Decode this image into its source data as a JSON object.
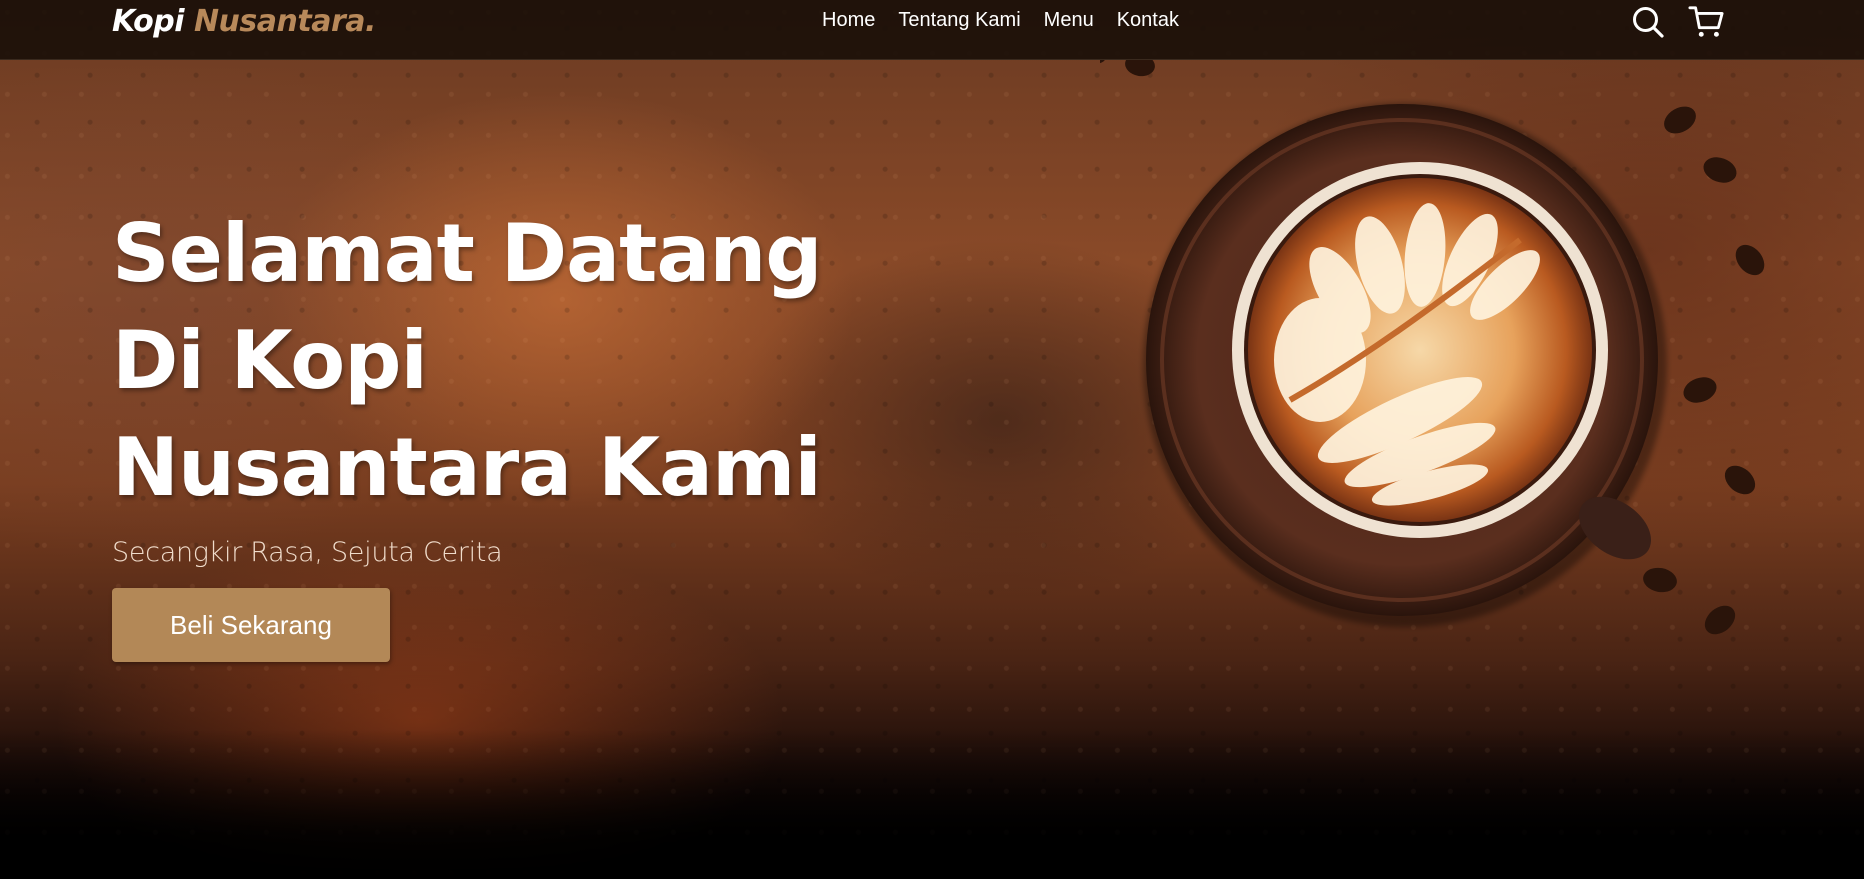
{
  "navbar": {
    "logo_primary": "Kopi",
    "logo_accent": "Nusantara.",
    "links": [
      {
        "label": "Home"
      },
      {
        "label": "Tentang Kami"
      },
      {
        "label": "Menu"
      },
      {
        "label": "Kontak"
      }
    ],
    "icons": [
      "search-icon",
      "shopping-cart-icon"
    ]
  },
  "hero": {
    "headline_lines": [
      "Selamat Datang",
      "Di Kopi",
      "Nusantara Kami"
    ],
    "tagline": "Secangkir Rasa, Sejuta Cerita",
    "cta_label": "Beli Sekarang",
    "background_image": "coffee-cup-latte-art"
  },
  "colors": {
    "accent": "#b8895a",
    "button": "#b38857",
    "navbar_bg": "#180e08",
    "text": "#ffffff"
  }
}
